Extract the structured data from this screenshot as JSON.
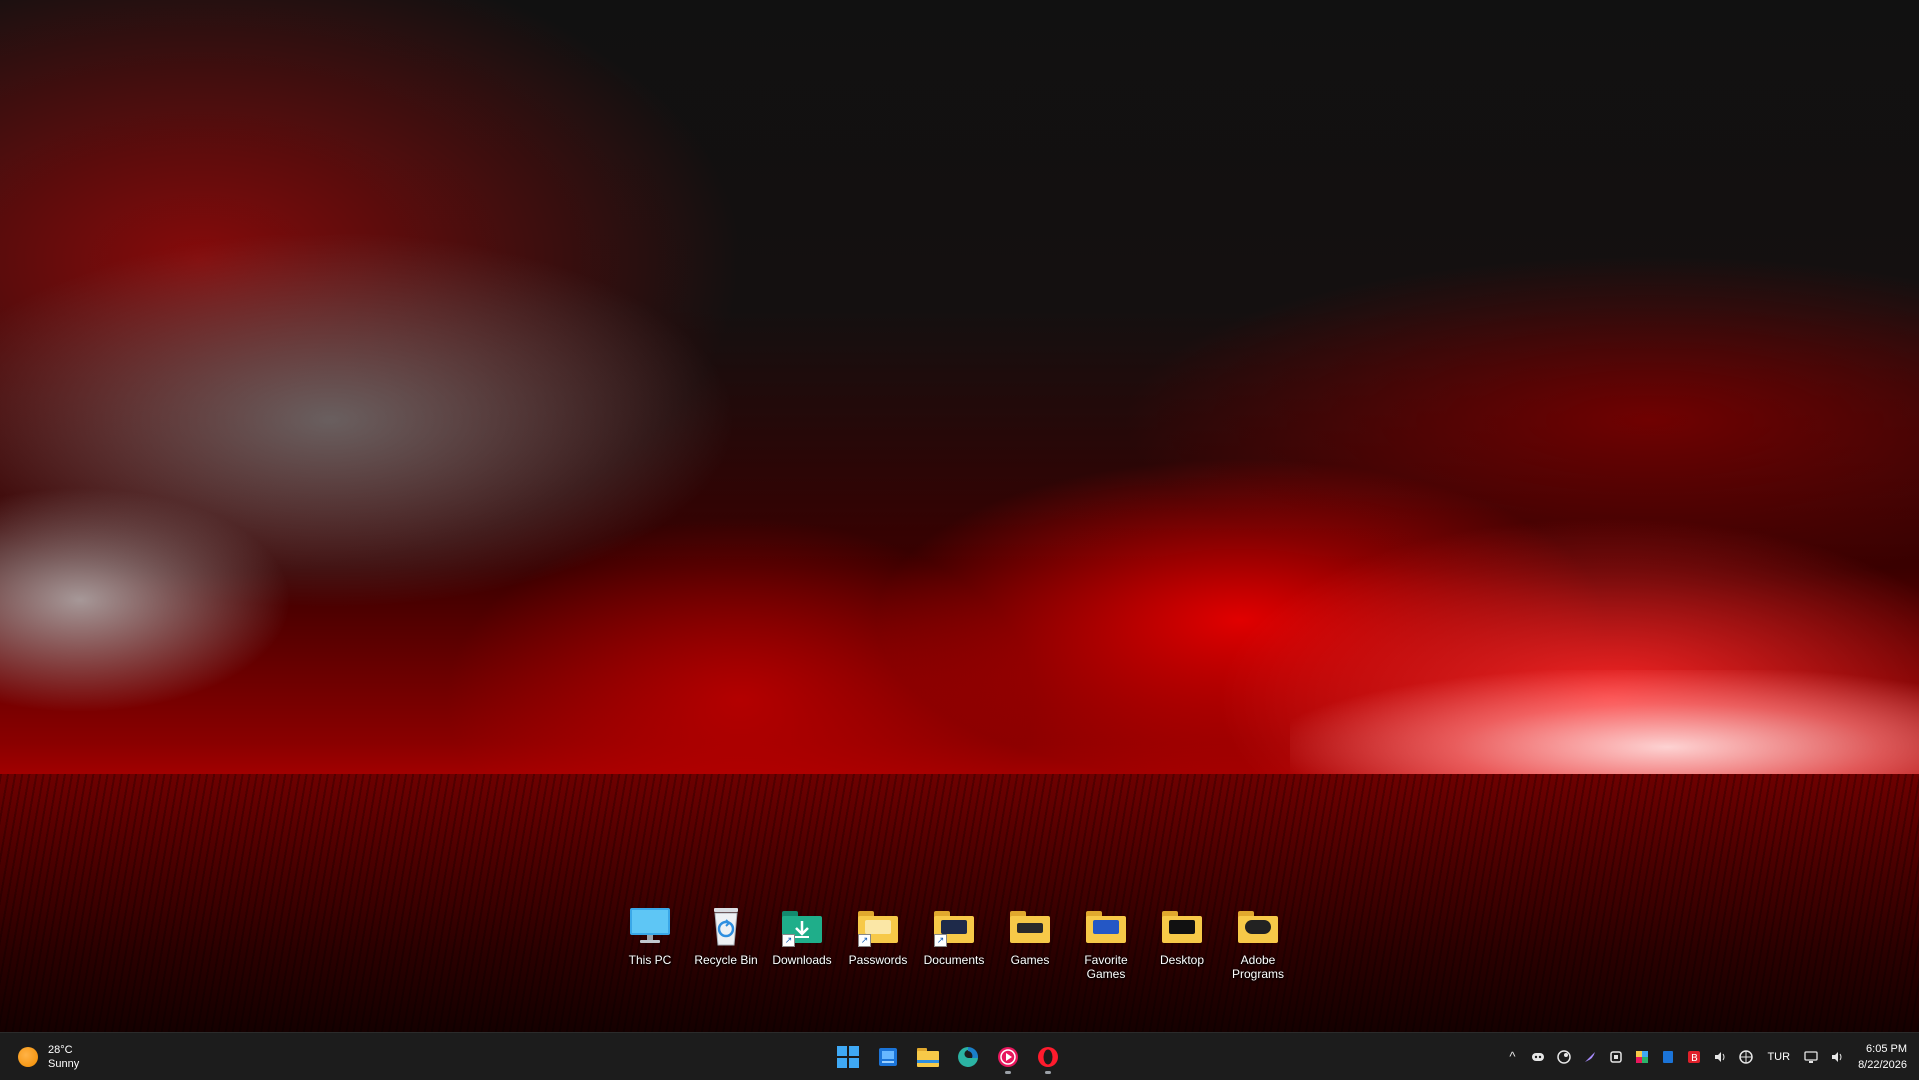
{
  "desktop": {
    "icons": [
      {
        "label": "This PC",
        "icon": "this-pc-icon"
      },
      {
        "label": "Recycle Bin",
        "icon": "recycle-bin-icon"
      },
      {
        "label": "Downloads",
        "icon": "downloads-folder-icon"
      },
      {
        "label": "Passwords",
        "icon": "folder-icon"
      },
      {
        "label": "Documents",
        "icon": "documents-folder-icon"
      },
      {
        "label": "Games",
        "icon": "games-folder-icon"
      },
      {
        "label": "Favorite Games",
        "icon": "favorite-games-folder-icon"
      },
      {
        "label": "Desktop",
        "icon": "desktop-folder-icon"
      },
      {
        "label": "Adobe Programs",
        "icon": "adobe-folder-icon"
      }
    ]
  },
  "taskbar": {
    "weather": {
      "temp": "28°C",
      "condition": "Sunny"
    },
    "apps": [
      {
        "name": "Start",
        "icon": "windows-start-icon"
      },
      {
        "name": "Widgets",
        "icon": "widgets-icon"
      },
      {
        "name": "File Explorer",
        "icon": "file-explorer-icon"
      },
      {
        "name": "Edge",
        "icon": "edge-icon"
      },
      {
        "name": "Music Player",
        "icon": "music-player-icon"
      },
      {
        "name": "Opera",
        "icon": "opera-icon"
      }
    ],
    "tray": {
      "language": "TUR",
      "time": "6:05 PM",
      "date": "8/22/2026"
    }
  },
  "colors": {
    "taskbar_bg": "#1c1c1c",
    "folder_yellow": "#f7c948",
    "accent_blue": "#0a84ff"
  }
}
